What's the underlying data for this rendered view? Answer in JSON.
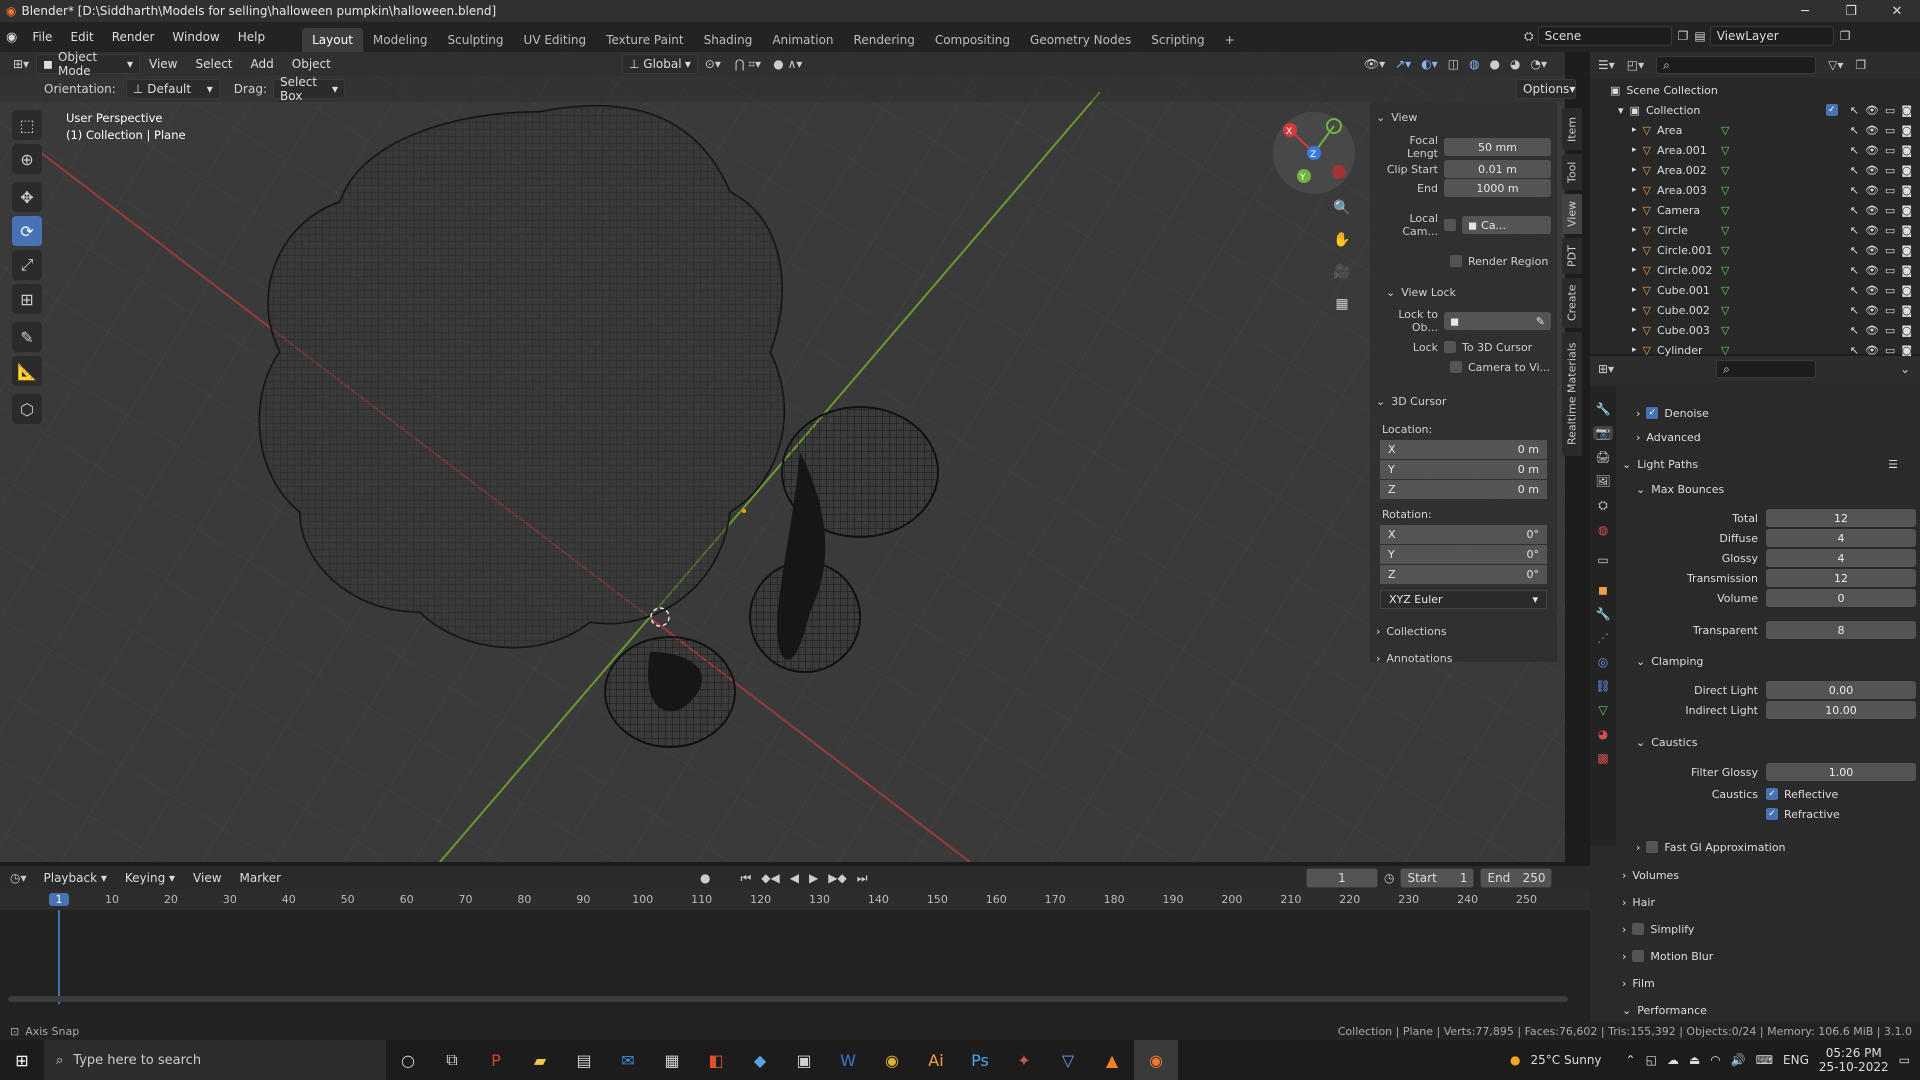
{
  "titlebar": {
    "text": "Blender* [D:\\Siddharth\\Models for selling\\halloween pumpkin\\halloween.blend]"
  },
  "menu": [
    "File",
    "Edit",
    "Render",
    "Window",
    "Help"
  ],
  "workspaces": [
    "Layout",
    "Modeling",
    "Sculpting",
    "UV Editing",
    "Texture Paint",
    "Shading",
    "Animation",
    "Rendering",
    "Compositing",
    "Geometry Nodes",
    "Scripting"
  ],
  "scene": {
    "name": "Scene",
    "view_layer": "ViewLayer"
  },
  "viewport_header": {
    "mode": "Object Mode",
    "menus": [
      "View",
      "Select",
      "Add",
      "Object"
    ],
    "transform": "Global"
  },
  "viewport_header2": {
    "orientation_label": "Orientation:",
    "orientation_value": "Default",
    "drag_label": "Drag:",
    "drag_value": "Select Box",
    "options": "Options"
  },
  "viewport_overlay": {
    "line1": "User Perspective",
    "line2": "(1) Collection | Plane"
  },
  "npanel": {
    "tabs": [
      "Item",
      "Tool",
      "View",
      "PDT",
      "Create",
      "Realtime Materials"
    ],
    "view_header": "View",
    "focal_label": "Focal Lengt",
    "focal_value": "50 mm",
    "clip_start_label": "Clip Start",
    "clip_start_value": "0.01 m",
    "end_label": "End",
    "end_value": "1000 m",
    "local_cam_label": "Local Cam...",
    "local_cam_value": "Ca...",
    "render_region": "Render Region",
    "view_lock_header": "View Lock",
    "lock_to_label": "Lock to Ob...",
    "lock_label": "Lock",
    "to_3d_cursor": "To 3D Cursor",
    "camera_to_view": "Camera to Vi...",
    "cursor_header": "3D Cursor",
    "location_label": "Location:",
    "loc": [
      {
        "axis": "X",
        "value": "0 m"
      },
      {
        "axis": "Y",
        "value": "0 m"
      },
      {
        "axis": "Z",
        "value": "0 m"
      }
    ],
    "rotation_label": "Rotation:",
    "rot": [
      {
        "axis": "X",
        "value": "0°"
      },
      {
        "axis": "Y",
        "value": "0°"
      },
      {
        "axis": "Z",
        "value": "0°"
      }
    ],
    "euler": "XYZ Euler",
    "collections": "Collections",
    "annotations": "Annotations"
  },
  "outliner": {
    "scene_collection": "Scene Collection",
    "collection": "Collection",
    "items": [
      "Area",
      "Area.001",
      "Area.002",
      "Area.003",
      "Camera",
      "Circle",
      "Circle.001",
      "Circle.002",
      "Cube.001",
      "Cube.002",
      "Cube.003",
      "Cylinder"
    ]
  },
  "properties": {
    "denoise": "Denoise",
    "advanced": "Advanced",
    "light_paths": "Light Paths",
    "max_bounces": "Max Bounces",
    "bounces": [
      {
        "label": "Total",
        "value": "12"
      },
      {
        "label": "Diffuse",
        "value": "4"
      },
      {
        "label": "Glossy",
        "value": "4"
      },
      {
        "label": "Transmission",
        "value": "12"
      },
      {
        "label": "Volume",
        "value": "0"
      },
      {
        "label": "Transparent",
        "value": "8"
      }
    ],
    "clamping": "Clamping",
    "direct_light_label": "Direct Light",
    "direct_light_value": "0.00",
    "indirect_light_label": "Indirect Light",
    "indirect_light_value": "10.00",
    "caustics": "Caustics",
    "filter_glossy_label": "Filter Glossy",
    "filter_glossy_value": "1.00",
    "caustics_label": "Caustics",
    "reflective": "Reflective",
    "refractive": "Refractive",
    "fast_gi": "Fast GI Approximation",
    "sections": [
      "Volumes",
      "Hair",
      "Simplify",
      "Motion Blur",
      "Film",
      "Performance"
    ]
  },
  "timeline": {
    "menus": [
      "Playback",
      "Keying",
      "View",
      "Marker"
    ],
    "current_frame": "1",
    "start_label": "Start",
    "start_value": "1",
    "end_label": "End",
    "end_value": "250",
    "ticks": [
      "1",
      "10",
      "20",
      "30",
      "40",
      "50",
      "60",
      "70",
      "80",
      "90",
      "100",
      "110",
      "120",
      "130",
      "140",
      "150",
      "160",
      "170",
      "180",
      "190",
      "200",
      "210",
      "220",
      "230",
      "240",
      "250"
    ]
  },
  "statusbar": {
    "left": "Axis Snap",
    "right": "Collection | Plane | Verts:77,895 | Faces:76,602 | Tris:155,392 | Objects:0/24 | Memory: 106.6 MiB | 3.1.0"
  },
  "taskbar": {
    "search": "Type here to search",
    "weather": "25°C  Sunny",
    "lang": "ENG",
    "time": "05:26 PM",
    "date": "25-10-2022"
  }
}
